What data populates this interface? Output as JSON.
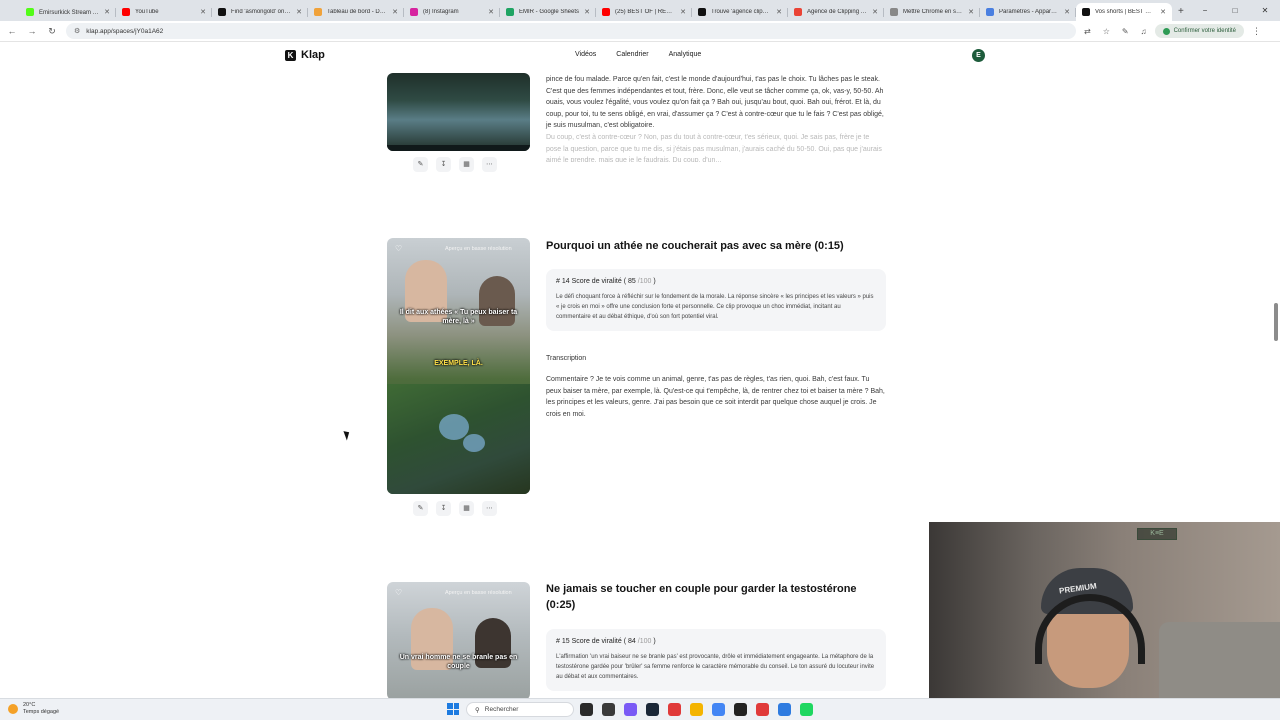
{
  "browser": {
    "tabs": [
      {
        "label": "Emirsurkick Stream - ☰",
        "color": "#53fc18"
      },
      {
        "label": "YouTube",
        "color": "#ff0000"
      },
      {
        "label": "Find 'asmongold' on T…",
        "color": "#111111"
      },
      {
        "label": "Tableau de bord - Dom…",
        "color": "#f0a23a"
      },
      {
        "label": "(8) Instagram",
        "color": "#d6249f"
      },
      {
        "label": "EMIR - Google Sheets",
        "color": "#1fa463"
      },
      {
        "label": "(25) BEST OF | REDIFF…",
        "color": "#ff0000"
      },
      {
        "label": "Trouve 'agence clippin…",
        "color": "#111111"
      },
      {
        "label": "Agence de Clipping Tik…",
        "color": "#ea4335"
      },
      {
        "label": "Mettre Chrome en sou…",
        "color": "#888888"
      },
      {
        "label": "Paramètres - Apparenc…",
        "color": "#4a7fe0"
      },
      {
        "label": "Vos shorts | BEST O…",
        "color": "#111111",
        "active": true
      }
    ],
    "new_tab": "+",
    "window_controls": [
      "−",
      "□",
      "✕"
    ],
    "url": "klap.app/spaces/jY0a1A62",
    "confirm_identity": "Confirmer votre identité"
  },
  "app": {
    "logo": "Klap",
    "nav": [
      "Vidéos",
      "Calendrier",
      "Analytique"
    ],
    "avatar": "E"
  },
  "clips": {
    "partial": {
      "transcript_visible": "pince de fou malade. Parce qu'en fait, c'est le monde d'aujourd'hui, t'as pas le choix. Tu lâches pas le steak. C'est que des femmes indépendantes et tout, frère. Donc, elle veut se tâcher comme ça, ok, vas-y, 50-50. Ah ouais, vous voulez l'égalité, vous voulez qu'on fait ça ? Bah oui, jusqu'au bout, quoi. Bah oui, frérot. Et là, du coup, pour toi, tu te sens obligé, en vrai, d'assumer ça ? C'est à contre-cœur que tu le fais ? C'est pas obligé, je suis musulman, c'est obligatoire.",
      "transcript_faded": "Du coup, c'est à contre-cœur ? Non, pas du tout à contre-cœur, t'es sérieux, quoi. Je sais pas, frère je te pose la question, parce que tu me dis, si j'étais pas musulman, j'aurais caché du 50-50. Oui, pas que j'aurais aimé le prendre, mais que je le faudrais. Du coup, d'un..."
    },
    "clip14": {
      "title": "Pourquoi un athée ne coucherait pas avec sa mère (0:15)",
      "preview_label": "Aperçu en basse résolution",
      "caption_top": "Il dit aux athées « Tu peux baiser ta mère, là »",
      "caption_bottom": "EXEMPLE, LÀ.",
      "score_prefix": "# 14 Score de viralité (",
      "score": "85",
      "score_max": "/100",
      "score_suffix": ")",
      "description": "Le défi choquant force à réfléchir sur le fondement de la morale. La réponse sincère « les principes et les valeurs » puis « je crois en moi » offre une conclusion forte et personnelle. Ce clip provoque un choc immédiat, incitant au commentaire et au débat éthique, d'où son fort potentiel viral.",
      "transcript_label": "Transcription",
      "transcript": "Commentaire ? Je te vois comme un animal, genre, t'as pas de règles, t'as rien, quoi. Bah, c'est faux. Tu peux baiser ta mère, par exemple, là. Qu'est-ce qui t'empêche, là, de rentrer chez toi et baiser ta mère ? Bah, les principes et les valeurs, genre. J'ai pas besoin que ce soit interdit par quelque chose auquel je crois. Je crois en moi."
    },
    "clip15": {
      "title": "Ne jamais se toucher en couple pour garder la testostérone (0:25)",
      "preview_label": "Aperçu en basse résolution",
      "caption": "Un vrai homme ne se branle pas en couple",
      "score_prefix": "# 15 Score de viralité (",
      "score": "84",
      "score_max": "/100",
      "score_suffix": ")",
      "description": "L'affirmation 'un vrai baiseur ne se branle pas' est provocante, drôle et immédiatement engageante. La métaphore de la testostérone gardée pour 'brûler' sa femme renforce le caractère mémorable du conseil. Le ton assuré du locuteur invite au débat et aux commentaires."
    }
  },
  "taskbar": {
    "temperature": "20°C",
    "weather": "Temps dégagé",
    "search_placeholder": "Rechercher",
    "app_colors": [
      "#2b2b2b",
      "#3a3a3a",
      "#7a5af5",
      "#1b2838",
      "#e03a3a",
      "#f4b400",
      "#4285f4",
      "#222222",
      "#e03a3a",
      "#2e7be0",
      "#1ed760"
    ]
  },
  "webcam": {
    "cap_text": "PREMIUM",
    "logo_text": "K≡E"
  }
}
